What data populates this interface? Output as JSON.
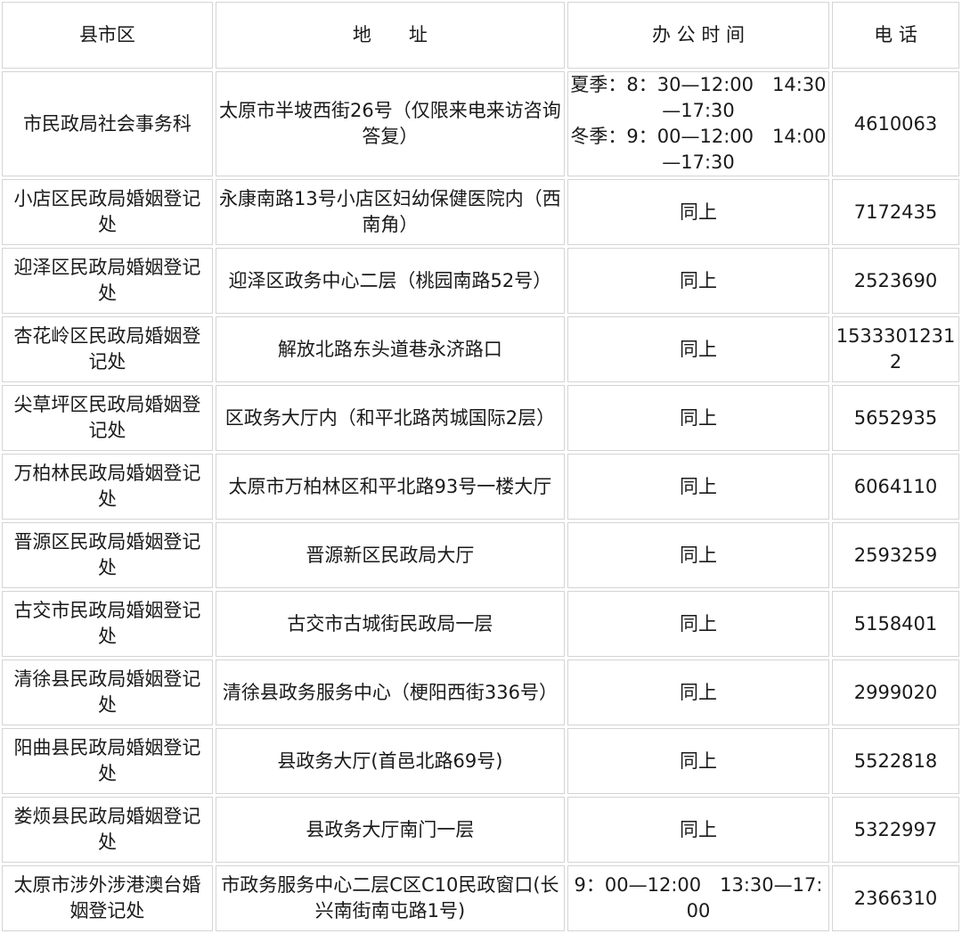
{
  "table": {
    "headers": [
      "县市区",
      "地　　址",
      "办 公 时 间",
      "电 话"
    ],
    "rows": [
      {
        "area": "市民政局社会事务科",
        "address": "太原市半坡西街26号（仅限来电来访咨询答复）",
        "hours": [
          "夏季：8：30—12:00　14:30—17:30",
          "冬季：9：00—12:00　14:00—17:30"
        ],
        "phone": "4610063"
      },
      {
        "area": "小店区民政局婚姻登记处",
        "address": "永康南路13号小店区妇幼保健医院内（西南角）",
        "hours": [
          "同上"
        ],
        "phone": "7172435"
      },
      {
        "area": "迎泽区民政局婚姻登记处",
        "address": "迎泽区政务中心二层（桃园南路52号）",
        "hours": [
          "同上"
        ],
        "phone": "2523690"
      },
      {
        "area": "杏花岭区民政局婚姻登记处",
        "address": "解放北路东头道巷永济路口",
        "hours": [
          "同上"
        ],
        "phone": "15333012312"
      },
      {
        "area": "尖草坪区民政局婚姻登记处",
        "address": "区政务大厅内（和平北路芮城国际2层）",
        "hours": [
          "同上"
        ],
        "phone": "5652935"
      },
      {
        "area": "万柏林民政局婚姻登记处",
        "address": "太原市万柏林区和平北路93号一楼大厅",
        "hours": [
          "同上"
        ],
        "phone": "6064110"
      },
      {
        "area": "晋源区民政局婚姻登记处",
        "address": "晋源新区民政局大厅",
        "hours": [
          "同上"
        ],
        "phone": "2593259"
      },
      {
        "area": "古交市民政局婚姻登记处",
        "address": "古交市古城街民政局一层",
        "hours": [
          "同上"
        ],
        "phone": "5158401"
      },
      {
        "area": "清徐县民政局婚姻登记处",
        "address": "清徐县政务服务中心（梗阳西街336号）",
        "hours": [
          "同上"
        ],
        "phone": "2999020"
      },
      {
        "area": "阳曲县民政局婚姻登记处",
        "address": "县政务大厅(首邑北路69号)",
        "hours": [
          "同上"
        ],
        "phone": "5522818"
      },
      {
        "area": "娄烦县民政局婚姻登记处",
        "address": "县政务大厅南门一层",
        "hours": [
          "同上"
        ],
        "phone": "5322997"
      },
      {
        "area": "太原市涉外涉港澳台婚姻登记处",
        "address": "市政务服务中心二层C区C10民政窗口(长兴南街南屯路1号)",
        "hours": [
          "9：00—12:00　13:30—17:00"
        ],
        "phone": "2366310"
      }
    ]
  }
}
